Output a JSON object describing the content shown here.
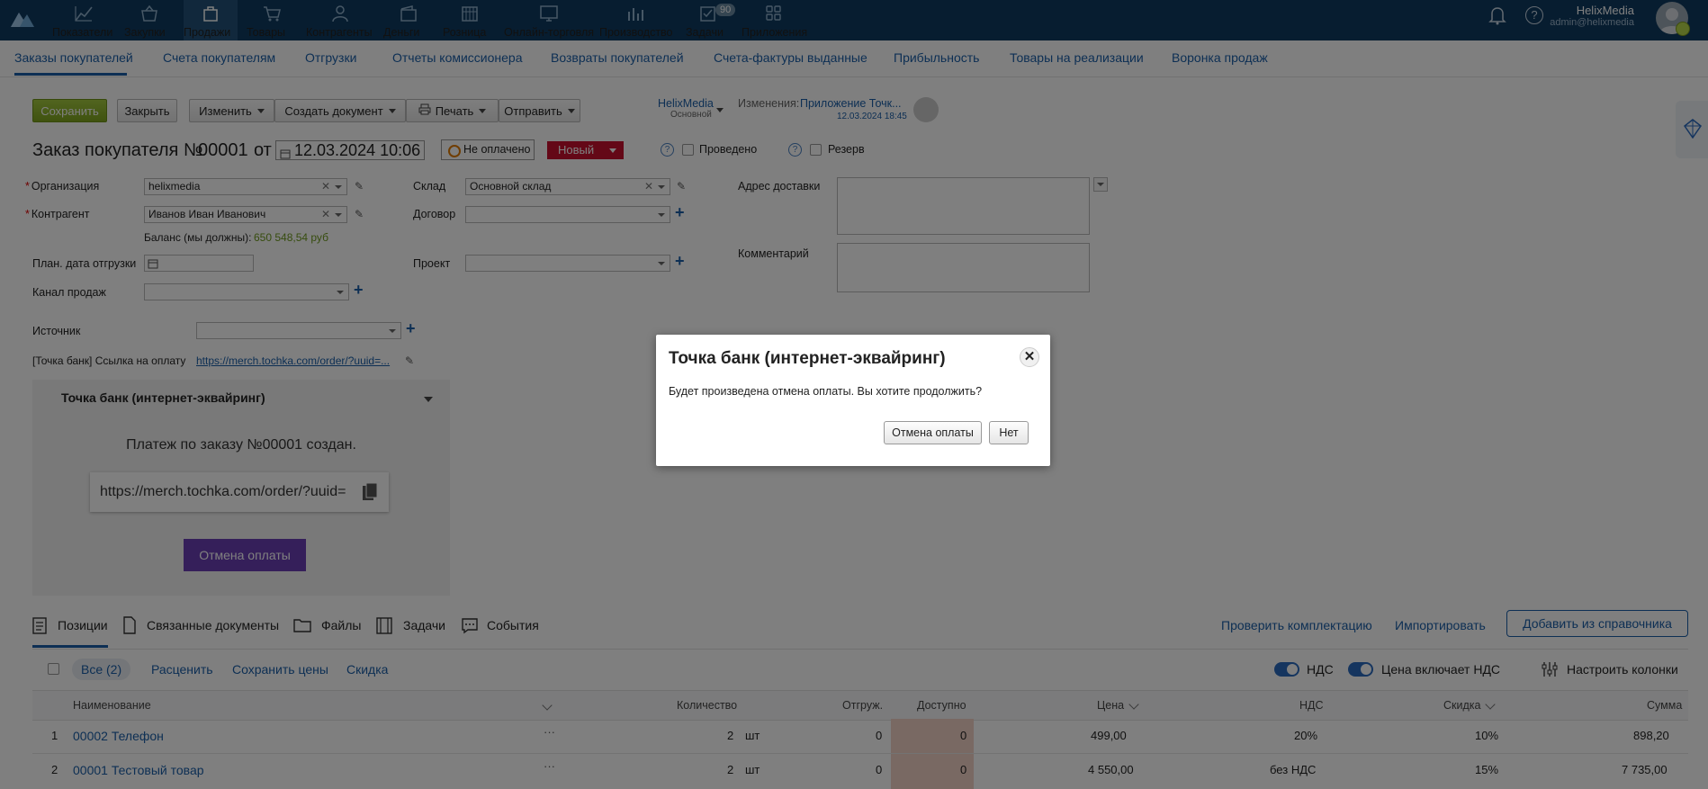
{
  "nav": {
    "items": [
      {
        "label": "Показатели",
        "icon": "chart-line-icon"
      },
      {
        "label": "Закупки",
        "icon": "basket-icon"
      },
      {
        "label": "Продажи",
        "icon": "bag-icon"
      },
      {
        "label": "Товары",
        "icon": "cart-icon"
      },
      {
        "label": "Контрагенты",
        "icon": "people-icon"
      },
      {
        "label": "Деньги",
        "icon": "wallet-icon"
      },
      {
        "label": "Розница",
        "icon": "store-icon"
      },
      {
        "label": "Онлайн-торговля",
        "icon": "online-store-icon"
      },
      {
        "label": "Производство",
        "icon": "factory-icon"
      },
      {
        "label": "Задачи",
        "icon": "tasks-icon"
      },
      {
        "label": "Приложения",
        "icon": "apps-icon"
      }
    ],
    "tasks_badge": "90",
    "user_name": "HelixMedia",
    "user_email": "admin@helixmedia"
  },
  "subnav": [
    "Заказы покупателей",
    "Счета покупателям",
    "Отгрузки",
    "Отчеты комиссионера",
    "Возвраты покупателей",
    "Счета-фактуры выданные",
    "Прибыльность",
    "Товары на реализации",
    "Воронка продаж"
  ],
  "toolbar": {
    "save": "Сохранить",
    "close": "Закрыть",
    "edit": "Изменить",
    "create_doc": "Создать документ",
    "print": "Печать",
    "send": "Отправить",
    "company": "HelixMedia",
    "company_sub": "Основной",
    "changes_label": "Изменения:",
    "changes_value": "Приложение Точк...",
    "changes_date": "12.03.2024 18:45"
  },
  "header": {
    "title": "Заказ покупателя №",
    "number": "00001",
    "from": "от",
    "date": "12.03.2024 10:06",
    "payment_status": "Не оплачено",
    "state": "Новый",
    "posted": "Проведено",
    "reserve": "Резерв"
  },
  "form": {
    "org_label": "Организация",
    "org_value": "helixmedia",
    "counterparty_label": "Контрагент",
    "counterparty_value": "Иванов Иван Иванович",
    "balance_label": "Баланс (мы должны):",
    "balance_value": "650 548,54 руб",
    "ship_date_label": "План. дата отгрузки",
    "channel_label": "Канал продаж",
    "source_label": "Источник",
    "pay_link_label": "[Точка банк] Ссылка на оплату",
    "pay_link_value": "https://merch.tochka.com/order/?uuid=...",
    "warehouse_label": "Склад",
    "warehouse_value": "Основной склад",
    "contract_label": "Договор",
    "project_label": "Проект",
    "address_label": "Адрес доставки",
    "comment_label": "Комментарий"
  },
  "widget": {
    "title": "Точка банк (интернет-эквайринг)",
    "message": "Платеж по заказу №00001 создан.",
    "url": "https://merch.tochka.com/order/?uuid=",
    "cancel": "Отмена оплаты"
  },
  "tabs": {
    "positions": "Позиции",
    "related": "Связанные документы",
    "files": "Файлы",
    "tasks": "Задачи",
    "events": "События",
    "check": "Проверить комплектацию",
    "import": "Импортировать",
    "add": "Добавить из справочника"
  },
  "filters": {
    "all": "Все (2)",
    "reprice": "Расценить",
    "save_prices": "Сохранить цены",
    "discount": "Скидка",
    "vat": "НДС",
    "price_incl_vat": "Цена включает НДС",
    "configure": "Настроить колонки"
  },
  "table": {
    "headers": {
      "name": "Наименование",
      "qty": "Количество",
      "shipped": "Отгруж.",
      "available": "Доступно",
      "price": "Цена",
      "vat": "НДС",
      "discount": "Скидка",
      "sum": "Сумма"
    },
    "rows": [
      {
        "n": "1",
        "name": "00002 Телефон",
        "qty": "2",
        "unit": "шт",
        "shipped": "0",
        "available": "0",
        "price": "499,00",
        "vat": "20%",
        "discount": "10%",
        "sum": "898,20"
      },
      {
        "n": "2",
        "name": "00001 Тестовый товар",
        "qty": "2",
        "unit": "шт",
        "shipped": "0",
        "available": "0",
        "price": "4 550,00",
        "vat": "без НДС",
        "discount": "15%",
        "sum": "7 735,00"
      }
    ]
  },
  "dialog": {
    "title": "Точка банк (интернет-эквайринг)",
    "message": "Будет произведена отмена оплаты. Вы хотите продолжить?",
    "confirm": "Отмена оплаты",
    "no": "Нет"
  },
  "colors": {
    "nav_bg": "#0f3a60",
    "link": "#1b5fa8",
    "save": "#8ab22a",
    "state_red": "#c8102e",
    "cancel_purple": "#6a3fb5"
  }
}
